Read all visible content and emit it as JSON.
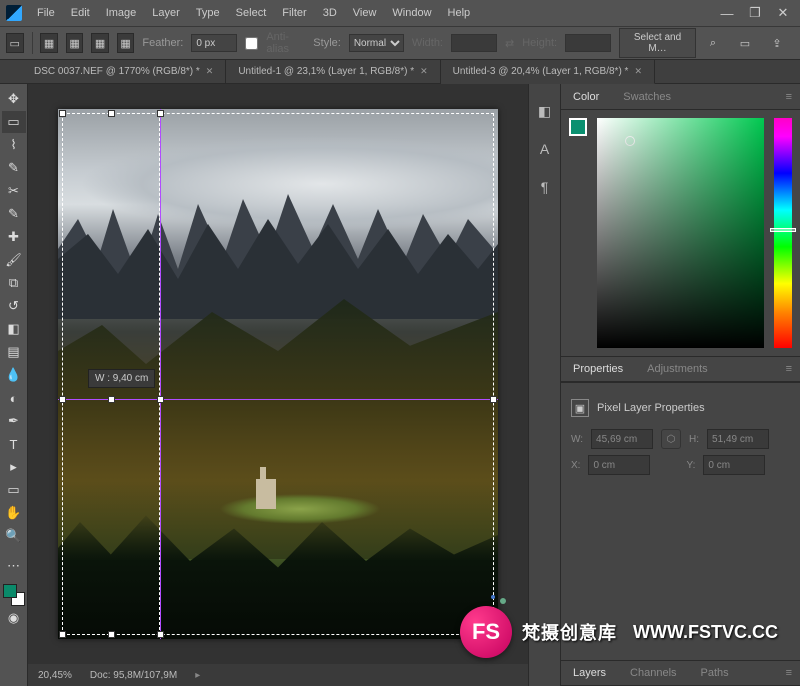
{
  "menu": [
    "File",
    "Edit",
    "Image",
    "Layer",
    "Type",
    "Select",
    "Filter",
    "3D",
    "View",
    "Window",
    "Help"
  ],
  "options": {
    "feather_label": "Feather:",
    "feather": "0 px",
    "anti_alias": "Anti-alias",
    "style_label": "Style:",
    "style": "Normal",
    "width_label": "Width:",
    "height_label": "Height:",
    "select_mask": "Select and M…"
  },
  "tabs": [
    {
      "label": "DSC 0037.NEF @ 1770% (RGB/8*) *",
      "active": false
    },
    {
      "label": "Untitled-1 @ 23,1% (Layer 1, RGB/8*) *",
      "active": false
    },
    {
      "label": "Untitled-3 @ 20,4% (Layer 1, RGB/8*) *",
      "active": true
    }
  ],
  "canvas": {
    "dim_label": "W : 9,40 cm"
  },
  "status": {
    "zoom": "20,45%",
    "doc": "Doc: 95,8M/107,9M"
  },
  "right": {
    "color_tab": "Color",
    "swatches_tab": "Swatches",
    "properties_tab": "Properties",
    "adjustments_tab": "Adjustments",
    "pixel_layer": "Pixel Layer Properties",
    "w_label": "W:",
    "w_val": "45,69 cm",
    "h_label": "H:",
    "h_val": "51,49 cm",
    "x_label": "X:",
    "x_val": "0 cm",
    "y_label": "Y:",
    "y_val": "0 cm",
    "layers_tab": "Layers",
    "channels_tab": "Channels",
    "paths_tab": "Paths"
  },
  "watermark": {
    "badge": "FS",
    "text": "梵摄创意库",
    "url": "WWW.FSTVC.CC"
  }
}
